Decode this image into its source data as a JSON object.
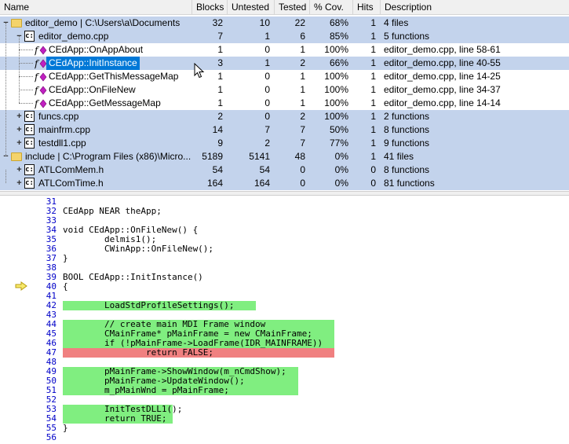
{
  "columns": [
    "Name",
    "Blocks",
    "Untested",
    "Tested",
    "% Cov.",
    "Hits",
    "Description"
  ],
  "rows": [
    {
      "kind": "folder",
      "level": 0,
      "exp": "−",
      "name": "editor_demo | C:\\Users\\a\\Documents",
      "blocks": "32",
      "untested": "10",
      "tested": "22",
      "cov": "68%",
      "hits": "1",
      "desc": "4 files",
      "style": "blue"
    },
    {
      "kind": "cpp",
      "level": 1,
      "exp": "−",
      "name": "editor_demo.cpp",
      "blocks": "7",
      "untested": "1",
      "tested": "6",
      "cov": "85%",
      "hits": "1",
      "desc": "5 functions",
      "style": "blue"
    },
    {
      "kind": "fn",
      "level": 2,
      "exp": "",
      "name": "CEdApp::OnAppAbout",
      "blocks": "1",
      "untested": "0",
      "tested": "1",
      "cov": "100%",
      "hits": "1",
      "desc": "editor_demo.cpp, line 58-61",
      "style": ""
    },
    {
      "kind": "fn",
      "level": 2,
      "exp": "",
      "name": "CEdApp::InitInstance",
      "blocks": "3",
      "untested": "1",
      "tested": "2",
      "cov": "66%",
      "hits": "1",
      "desc": "editor_demo.cpp, line 40-55",
      "style": "sel"
    },
    {
      "kind": "fn",
      "level": 2,
      "exp": "",
      "name": "CEdApp::GetThisMessageMap",
      "blocks": "1",
      "untested": "0",
      "tested": "1",
      "cov": "100%",
      "hits": "1",
      "desc": "editor_demo.cpp, line 14-25",
      "style": ""
    },
    {
      "kind": "fn",
      "level": 2,
      "exp": "",
      "name": "CEdApp::OnFileNew",
      "blocks": "1",
      "untested": "0",
      "tested": "1",
      "cov": "100%",
      "hits": "1",
      "desc": "editor_demo.cpp, line 34-37",
      "style": ""
    },
    {
      "kind": "fn",
      "level": 2,
      "exp": "",
      "name": "CEdApp::GetMessageMap",
      "blocks": "1",
      "untested": "0",
      "tested": "1",
      "cov": "100%",
      "hits": "1",
      "desc": "editor_demo.cpp, line 14-14",
      "style": ""
    },
    {
      "kind": "cpp",
      "level": 1,
      "exp": "+",
      "name": "funcs.cpp",
      "blocks": "2",
      "untested": "0",
      "tested": "2",
      "cov": "100%",
      "hits": "1",
      "desc": "2 functions",
      "style": "blue"
    },
    {
      "kind": "cpp",
      "level": 1,
      "exp": "+",
      "name": "mainfrm.cpp",
      "blocks": "14",
      "untested": "7",
      "tested": "7",
      "cov": "50%",
      "hits": "1",
      "desc": "8 functions",
      "style": "blue"
    },
    {
      "kind": "cpp",
      "level": 1,
      "exp": "+",
      "name": "testdll1.cpp",
      "blocks": "9",
      "untested": "2",
      "tested": "7",
      "cov": "77%",
      "hits": "1",
      "desc": "9 functions",
      "style": "blue"
    },
    {
      "kind": "folder",
      "level": 0,
      "exp": "−",
      "name": "include | C:\\Program Files (x86)\\Micro...",
      "blocks": "5189",
      "untested": "5141",
      "tested": "48",
      "cov": "0%",
      "hits": "1",
      "desc": "41 files",
      "style": "blue"
    },
    {
      "kind": "cpp",
      "level": 1,
      "exp": "+",
      "name": "ATLComMem.h",
      "blocks": "54",
      "untested": "54",
      "tested": "0",
      "cov": "0%",
      "hits": "0",
      "desc": "8 functions",
      "style": "blue"
    },
    {
      "kind": "cpp",
      "level": 1,
      "exp": "+",
      "name": "ATLComTime.h",
      "blocks": "164",
      "untested": "164",
      "tested": "0",
      "cov": "0%",
      "hits": "0",
      "desc": "81 functions",
      "style": "blue"
    }
  ],
  "code": [
    {
      "n": "31",
      "t": "",
      "h": ""
    },
    {
      "n": "32",
      "t": "CEdApp NEAR theApp;",
      "h": ""
    },
    {
      "n": "33",
      "t": "",
      "h": ""
    },
    {
      "n": "34",
      "t": "void CEdApp::OnFileNew() {",
      "h": ""
    },
    {
      "n": "35",
      "t": "        delmis1();",
      "h": ""
    },
    {
      "n": "36",
      "t": "        CWinApp::OnFileNew();",
      "h": ""
    },
    {
      "n": "37",
      "t": "}",
      "h": ""
    },
    {
      "n": "38",
      "t": "",
      "h": ""
    },
    {
      "n": "39",
      "t": "BOOL CEdApp::InitInstance()",
      "h": ""
    },
    {
      "n": "40",
      "t": "{",
      "h": ""
    },
    {
      "n": "41",
      "t": "",
      "h": ""
    },
    {
      "n": "42",
      "t": "        LoadStdProfileSettings();",
      "h": "g"
    },
    {
      "n": "43",
      "t": "",
      "h": ""
    },
    {
      "n": "44",
      "t": "        // create main MDI Frame window",
      "h": "g"
    },
    {
      "n": "45",
      "t": "        CMainFrame* pMainFrame = new CMainFrame;",
      "h": "g"
    },
    {
      "n": "46",
      "t": "        if (!pMainFrame->LoadFrame(IDR_MAINFRAME))",
      "h": "g"
    },
    {
      "n": "47",
      "t": "                return FALSE;",
      "h": "r"
    },
    {
      "n": "48",
      "t": "",
      "h": ""
    },
    {
      "n": "49",
      "t": "        pMainFrame->ShowWindow(m_nCmdShow);",
      "h": "g"
    },
    {
      "n": "50",
      "t": "        pMainFrame->UpdateWindow();",
      "h": "g"
    },
    {
      "n": "51",
      "t": "        m_pMainWnd = pMainFrame;",
      "h": "g"
    },
    {
      "n": "52",
      "t": "",
      "h": ""
    },
    {
      "n": "53",
      "t": "        InitTestDLL1();",
      "h": "g"
    },
    {
      "n": "54",
      "t": "        return TRUE;",
      "h": "g"
    },
    {
      "n": "55",
      "t": "}",
      "h": ""
    },
    {
      "n": "56",
      "t": "",
      "h": ""
    }
  ],
  "current_line_marker": "arrow-right-icon",
  "colors": {
    "row_blue": "#c3d3ec",
    "selected": "#0078d7",
    "covered": "#80ee80",
    "uncovered": "#f08080",
    "line_numbers": "#0000c8"
  }
}
